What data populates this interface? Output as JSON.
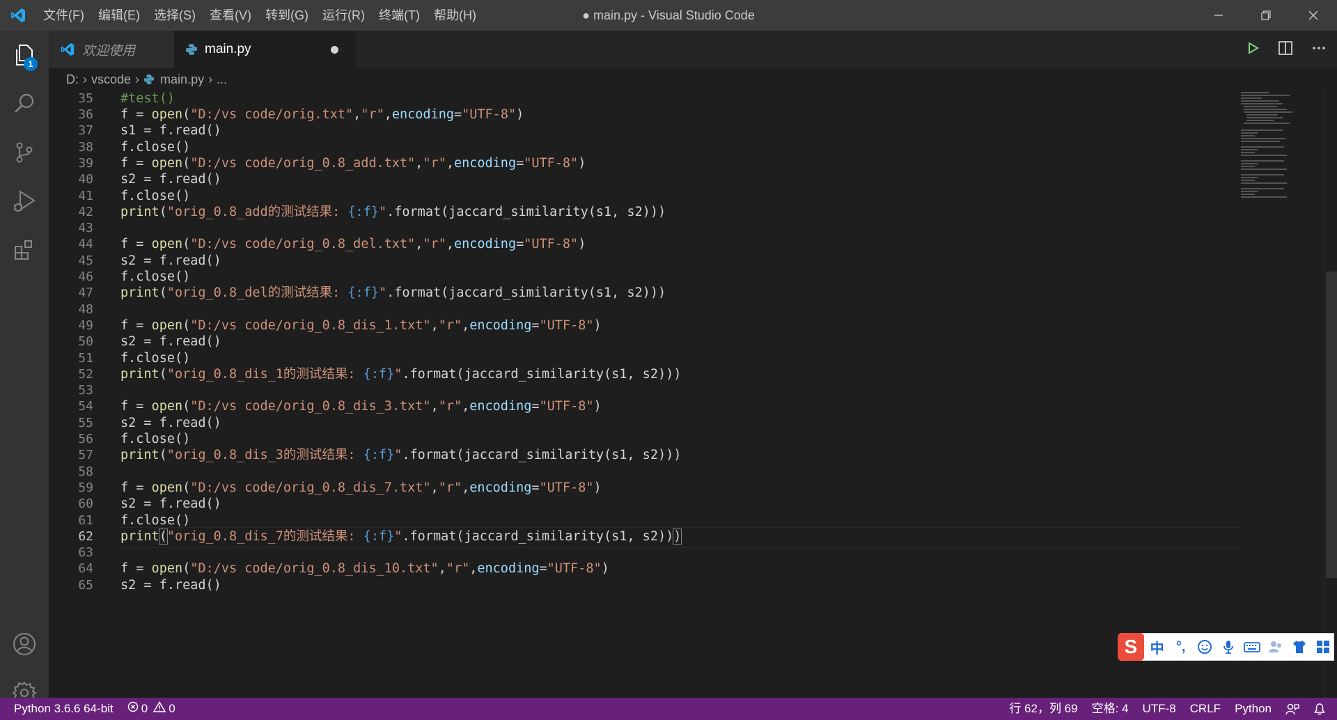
{
  "titlebar": {
    "menu": [
      "文件(F)",
      "编辑(E)",
      "选择(S)",
      "查看(V)",
      "转到(G)",
      "运行(R)",
      "终端(T)",
      "帮助(H)"
    ],
    "title": "● main.py - Visual Studio Code"
  },
  "activity": {
    "explorer_badge": "1"
  },
  "tabs": [
    {
      "label": "欢迎使用",
      "icon": "vscode-icon"
    },
    {
      "label": "main.py",
      "icon": "python-icon",
      "dirty": true
    }
  ],
  "breadcrumb": {
    "items": [
      "D:",
      "vscode",
      "main.py",
      "..."
    ]
  },
  "editor": {
    "current_line": 62,
    "lines": [
      {
        "n": "35",
        "tokens": [
          [
            "cm",
            "#test()"
          ]
        ]
      },
      {
        "n": "36",
        "tokens": [
          [
            "",
            "f = "
          ],
          [
            "fn",
            "open"
          ],
          [
            "",
            "("
          ],
          [
            "str",
            "\"D:/vs code/orig.txt\""
          ],
          [
            "",
            ","
          ],
          [
            "str",
            "\"r\""
          ],
          [
            "",
            ","
          ],
          [
            "kw",
            "encoding"
          ],
          [
            "",
            "="
          ],
          [
            "str",
            "\"UTF-8\""
          ],
          [
            "",
            ")"
          ]
        ]
      },
      {
        "n": "37",
        "tokens": [
          [
            "",
            "s1 = f.read()"
          ]
        ]
      },
      {
        "n": "38",
        "tokens": [
          [
            "",
            "f.close()"
          ]
        ]
      },
      {
        "n": "39",
        "tokens": [
          [
            "",
            "f = "
          ],
          [
            "fn",
            "open"
          ],
          [
            "",
            "("
          ],
          [
            "str",
            "\"D:/vs code/orig_0.8_add.txt\""
          ],
          [
            "",
            ","
          ],
          [
            "str",
            "\"r\""
          ],
          [
            "",
            ","
          ],
          [
            "kw",
            "encoding"
          ],
          [
            "",
            "="
          ],
          [
            "str",
            "\"UTF-8\""
          ],
          [
            "",
            ")"
          ]
        ]
      },
      {
        "n": "40",
        "tokens": [
          [
            "",
            "s2 = f.read()"
          ]
        ]
      },
      {
        "n": "41",
        "tokens": [
          [
            "",
            "f.close()"
          ]
        ]
      },
      {
        "n": "42",
        "tokens": [
          [
            "fn",
            "print"
          ],
          [
            "",
            "("
          ],
          [
            "str",
            "\"orig_0.8_add的测试结果: "
          ],
          [
            "fmt",
            "{:f}"
          ],
          [
            "str",
            "\""
          ],
          [
            "",
            ".format(jaccard_similarity(s1, s2)))"
          ]
        ]
      },
      {
        "n": "43",
        "tokens": []
      },
      {
        "n": "44",
        "tokens": [
          [
            "",
            "f = "
          ],
          [
            "fn",
            "open"
          ],
          [
            "",
            "("
          ],
          [
            "str",
            "\"D:/vs code/orig_0.8_del.txt\""
          ],
          [
            "",
            ","
          ],
          [
            "str",
            "\"r\""
          ],
          [
            "",
            ","
          ],
          [
            "kw",
            "encoding"
          ],
          [
            "",
            "="
          ],
          [
            "str",
            "\"UTF-8\""
          ],
          [
            "",
            ")"
          ]
        ]
      },
      {
        "n": "45",
        "tokens": [
          [
            "",
            "s2 = f.read()"
          ]
        ]
      },
      {
        "n": "46",
        "tokens": [
          [
            "",
            "f.close()"
          ]
        ]
      },
      {
        "n": "47",
        "tokens": [
          [
            "fn",
            "print"
          ],
          [
            "",
            "("
          ],
          [
            "str",
            "\"orig_0.8_del的测试结果: "
          ],
          [
            "fmt",
            "{:f}"
          ],
          [
            "str",
            "\""
          ],
          [
            "",
            ".format(jaccard_similarity(s1, s2)))"
          ]
        ]
      },
      {
        "n": "48",
        "tokens": []
      },
      {
        "n": "49",
        "tokens": [
          [
            "",
            "f = "
          ],
          [
            "fn",
            "open"
          ],
          [
            "",
            "("
          ],
          [
            "str",
            "\"D:/vs code/orig_0.8_dis_1.txt\""
          ],
          [
            "",
            ","
          ],
          [
            "str",
            "\"r\""
          ],
          [
            "",
            ","
          ],
          [
            "kw",
            "encoding"
          ],
          [
            "",
            "="
          ],
          [
            "str",
            "\"UTF-8\""
          ],
          [
            "",
            ")"
          ]
        ]
      },
      {
        "n": "50",
        "tokens": [
          [
            "",
            "s2 = f.read()"
          ]
        ]
      },
      {
        "n": "51",
        "tokens": [
          [
            "",
            "f.close()"
          ]
        ]
      },
      {
        "n": "52",
        "tokens": [
          [
            "fn",
            "print"
          ],
          [
            "",
            "("
          ],
          [
            "str",
            "\"orig_0.8_dis_1的测试结果: "
          ],
          [
            "fmt",
            "{:f}"
          ],
          [
            "str",
            "\""
          ],
          [
            "",
            ".format(jaccard_similarity(s1, s2)))"
          ]
        ]
      },
      {
        "n": "53",
        "tokens": []
      },
      {
        "n": "54",
        "tokens": [
          [
            "",
            "f = "
          ],
          [
            "fn",
            "open"
          ],
          [
            "",
            "("
          ],
          [
            "str",
            "\"D:/vs code/orig_0.8_dis_3.txt\""
          ],
          [
            "",
            ","
          ],
          [
            "str",
            "\"r\""
          ],
          [
            "",
            ","
          ],
          [
            "kw",
            "encoding"
          ],
          [
            "",
            "="
          ],
          [
            "str",
            "\"UTF-8\""
          ],
          [
            "",
            ")"
          ]
        ]
      },
      {
        "n": "55",
        "tokens": [
          [
            "",
            "s2 = f.read()"
          ]
        ]
      },
      {
        "n": "56",
        "tokens": [
          [
            "",
            "f.close()"
          ]
        ]
      },
      {
        "n": "57",
        "tokens": [
          [
            "fn",
            "print"
          ],
          [
            "",
            "("
          ],
          [
            "str",
            "\"orig_0.8_dis_3的测试结果: "
          ],
          [
            "fmt",
            "{:f}"
          ],
          [
            "str",
            "\""
          ],
          [
            "",
            ".format(jaccard_similarity(s1, s2)))"
          ]
        ]
      },
      {
        "n": "58",
        "tokens": []
      },
      {
        "n": "59",
        "tokens": [
          [
            "",
            "f = "
          ],
          [
            "fn",
            "open"
          ],
          [
            "",
            "("
          ],
          [
            "str",
            "\"D:/vs code/orig_0.8_dis_7.txt\""
          ],
          [
            "",
            ","
          ],
          [
            "str",
            "\"r\""
          ],
          [
            "",
            ","
          ],
          [
            "kw",
            "encoding"
          ],
          [
            "",
            "="
          ],
          [
            "str",
            "\"UTF-8\""
          ],
          [
            "",
            ")"
          ]
        ]
      },
      {
        "n": "60",
        "tokens": [
          [
            "",
            "s2 = f.read()"
          ]
        ]
      },
      {
        "n": "61",
        "tokens": [
          [
            "",
            "f.close()"
          ]
        ]
      },
      {
        "n": "62",
        "tokens": [
          [
            "fn",
            "print"
          ],
          [
            "bm",
            "("
          ],
          [
            "str",
            "\"orig_0.8_dis_7的测试结果: "
          ],
          [
            "fmt",
            "{:f}"
          ],
          [
            "str",
            "\""
          ],
          [
            "",
            ".format(jaccard_similarity(s1, s2))"
          ],
          [
            "bm",
            ")"
          ]
        ]
      },
      {
        "n": "63",
        "tokens": []
      },
      {
        "n": "64",
        "tokens": [
          [
            "",
            "f = "
          ],
          [
            "fn",
            "open"
          ],
          [
            "",
            "("
          ],
          [
            "str",
            "\"D:/vs code/orig_0.8_dis_10.txt\""
          ],
          [
            "",
            ","
          ],
          [
            "str",
            "\"r\""
          ],
          [
            "",
            ","
          ],
          [
            "kw",
            "encoding"
          ],
          [
            "",
            "="
          ],
          [
            "str",
            "\"UTF-8\""
          ],
          [
            "",
            ")"
          ]
        ]
      },
      {
        "n": "65",
        "tokens": [
          [
            "",
            "s2 = f.read()"
          ]
        ]
      }
    ]
  },
  "statusbar": {
    "interpreter": "Python 3.6.6 64-bit",
    "errors": "0",
    "warnings": "0",
    "cursor": "行 62，列 69",
    "indent": "空格: 4",
    "encoding": "UTF-8",
    "eol": "CRLF",
    "language": "Python"
  },
  "ime": {
    "mode": "中",
    "punct": "°,"
  },
  "colors": {
    "statusbar": "#68217a",
    "titlebar": "#3c3c3c",
    "accent": "#007acc"
  }
}
